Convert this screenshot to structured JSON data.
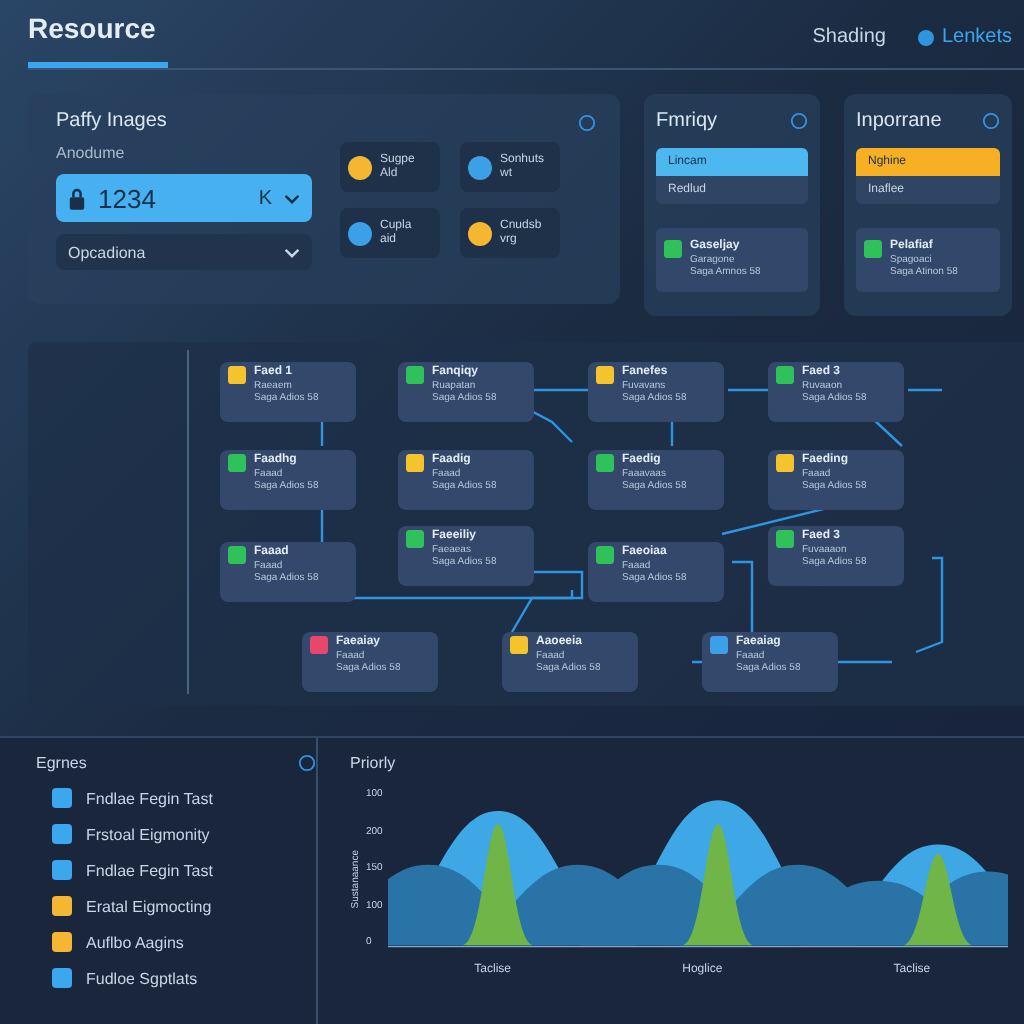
{
  "header": {
    "title": "Resource",
    "links": [
      {
        "label": "Shading",
        "dot": false
      },
      {
        "label": "Lenkets",
        "dot": true
      }
    ]
  },
  "image_panel": {
    "title": "Paffy Inages",
    "field_label": "Anodume",
    "field_value": "1234",
    "field_suffix": "K",
    "dropdown": "Opcadiona",
    "tiles": [
      {
        "title": "Sugpe",
        "sub": "Ald",
        "color": "#f5b731"
      },
      {
        "title": "Sonhuts",
        "sub": "wt",
        "color": "#3ba0e8"
      },
      {
        "title": "Cupla",
        "sub": "aid",
        "color": "#3ba0e8"
      },
      {
        "title": "Cnudsb",
        "sub": "vrg",
        "color": "#f5b731"
      }
    ]
  },
  "status_panels": [
    {
      "title": "Fmriqy",
      "color": "#4db8f0",
      "items": [
        {
          "label": "Lincam",
          "selected": true
        },
        {
          "label": "Redlud",
          "selected": false
        }
      ],
      "card": {
        "title": "Gaseljay",
        "sub": "Garagone",
        "meta": "Saga Amnos 58"
      }
    },
    {
      "title": "Inporrane",
      "color": "#f7b024",
      "items": [
        {
          "label": "Nghine",
          "selected": true
        },
        {
          "label": "Inaflee",
          "selected": false
        }
      ],
      "card": {
        "title": "Pelafiaf",
        "sub": "Spagoaci",
        "meta": "Saga Atinon 58"
      }
    }
  ],
  "diagram": {
    "nodes": [
      {
        "title": "Faed 1",
        "sub": "Raeaem",
        "meta": "Saga Adios 58",
        "color": "#f5c42c"
      },
      {
        "title": "Fanqiqy",
        "sub": "Ruapatan",
        "meta": "Saga Adios 58",
        "color": "#2fc25b"
      },
      {
        "title": "Fanefes",
        "sub": "Fuvavans",
        "meta": "Saga Adios 58",
        "color": "#f5c42c"
      },
      {
        "title": "Faed 3",
        "sub": "Ruvaaon",
        "meta": "Saga Adios 58",
        "color": "#2fc25b"
      },
      {
        "title": "Faadhg",
        "sub": "Faaad",
        "meta": "Saga Adios 58",
        "color": "#2fc25b"
      },
      {
        "title": "Faadig",
        "sub": "Faaad",
        "meta": "Saga Adios 58",
        "color": "#f5c42c"
      },
      {
        "title": "Faedig",
        "sub": "Faaavaas",
        "meta": "Saga Adios 58",
        "color": "#2fc25b"
      },
      {
        "title": "Faeding",
        "sub": "Faaad",
        "meta": "Saga Adios 58",
        "color": "#f5c42c"
      },
      {
        "title": "Faaad",
        "sub": "Faaad",
        "meta": "Saga Adios 58",
        "color": "#2fc25b"
      },
      {
        "title": "Faeeiliy",
        "sub": "Faeaeas",
        "meta": "Saga Adios 58",
        "color": "#2fc25b"
      },
      {
        "title": "Faeoiaa",
        "sub": "Faaad",
        "meta": "Saga Adios 58",
        "color": "#2fc25b"
      },
      {
        "title": "Faed 3",
        "sub": "Fuvaaaon",
        "meta": "Saga Adios 58",
        "color": "#2fc25b"
      },
      {
        "title": "Faeaiay",
        "sub": "Faaad",
        "meta": "Saga Adios 58",
        "color": "#e8466c"
      },
      {
        "title": "Aaoeeia",
        "sub": "Faaad",
        "meta": "Saga Adios 58",
        "color": "#f5c42c"
      },
      {
        "title": "Faeaiag",
        "sub": "Faaad",
        "meta": "Saga Adios 58",
        "color": "#3ba0e8"
      }
    ]
  },
  "legend": {
    "title": "Egrnes",
    "items": [
      {
        "label": "Fndlae Fegin Tast",
        "color": "#3ba7ee"
      },
      {
        "label": "Frstoal Eigmonity",
        "color": "#3ba7ee"
      },
      {
        "label": "Fndlae Fegin Tast",
        "color": "#3ba7ee"
      },
      {
        "label": "Eratal Eigmocting",
        "color": "#f5b731"
      },
      {
        "label": "Auflbo Aagins",
        "color": "#f5b731"
      },
      {
        "label": "Fudloe Sgptlats",
        "color": "#3ba7ee"
      }
    ]
  },
  "chart": {
    "title": "Priorly",
    "ylabel": "Sustanaance",
    "yticks": [
      "100",
      "200",
      "150",
      "100",
      "0"
    ],
    "xlabels": [
      "Taclise",
      "Hoglice",
      "Taclise"
    ]
  }
}
